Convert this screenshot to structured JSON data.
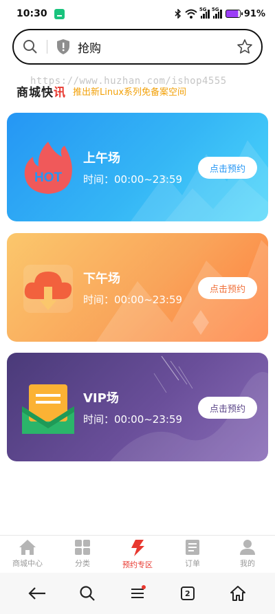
{
  "status_bar": {
    "time": "10:30",
    "network_labels": [
      "5G",
      "5G"
    ],
    "battery_percent": "91%"
  },
  "search": {
    "query": "抢购",
    "icons": [
      "search-icon",
      "shield-alert-icon",
      "star-icon"
    ]
  },
  "notice": {
    "logo_main": "商城快",
    "logo_accent": "讯",
    "text": "推出新Linux系列免备案空间",
    "watermark": "https://www.huzhan.com/ishop4555"
  },
  "sessions": [
    {
      "title": "上午场",
      "time_label": "时间：",
      "time_range": "00:00~23:59",
      "button": "点击预约",
      "icon": "hot-flame-icon",
      "colors": {
        "from": "#2596f4",
        "to": "#4dd7fb"
      }
    },
    {
      "title": "下午场",
      "time_label": "时间：",
      "time_range": "00:00~23:59",
      "button": "点击预约",
      "icon": "cloud-download-icon",
      "colors": {
        "from": "#fbc76c",
        "to": "#ff7e3d"
      }
    },
    {
      "title": "VIP场",
      "time_label": "时间：",
      "time_range": "00:00~23:59",
      "button": "点击预约",
      "icon": "envelope-icon",
      "colors": {
        "from": "#4a3a79",
        "to": "#8a6db8"
      }
    }
  ],
  "tabbar": {
    "items": [
      {
        "label": "商城中心",
        "icon": "home-icon",
        "active": false
      },
      {
        "label": "分类",
        "icon": "grid-icon",
        "active": false
      },
      {
        "label": "预约专区",
        "icon": "lightning-icon",
        "active": true
      },
      {
        "label": "订单",
        "icon": "document-icon",
        "active": false
      },
      {
        "label": "我的",
        "icon": "user-icon",
        "active": false
      }
    ],
    "active_color": "#e8382f"
  },
  "system_nav": {
    "tabs_count": "2",
    "icons": [
      "back-arrow-icon",
      "search-icon",
      "menu-icon",
      "tabs-icon",
      "home-icon"
    ]
  }
}
